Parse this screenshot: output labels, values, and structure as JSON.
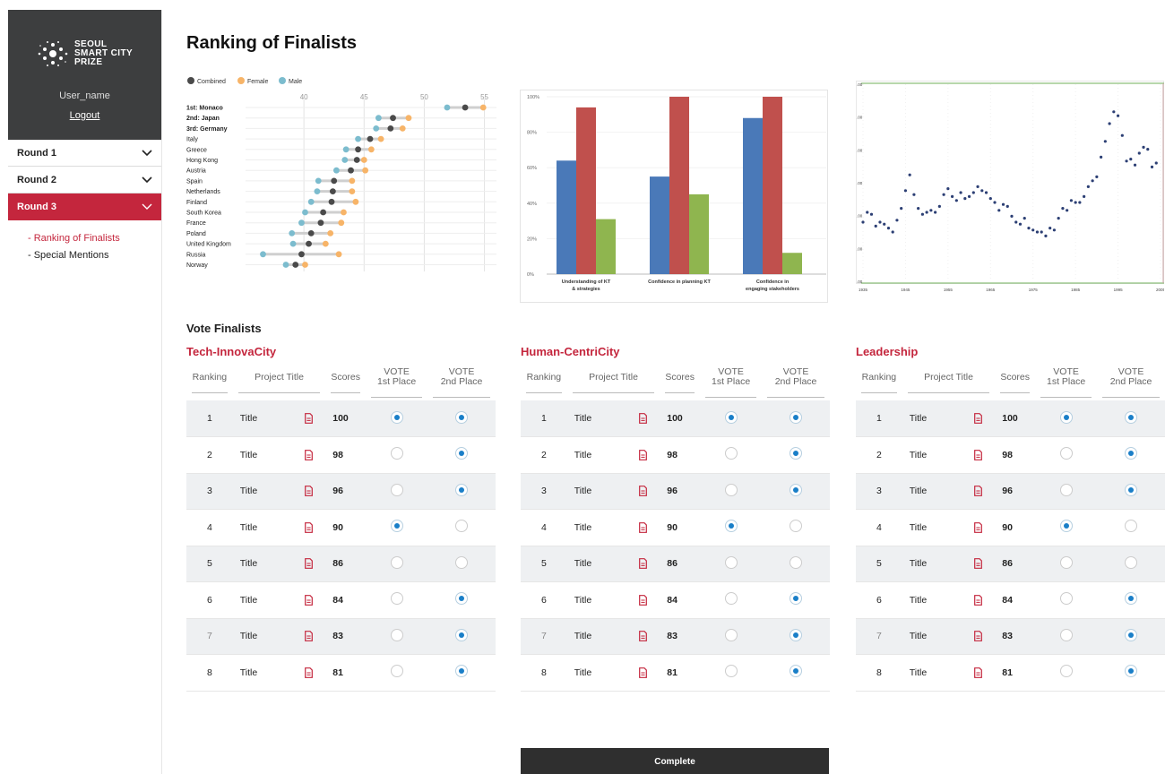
{
  "brand": {
    "logo_lines": [
      "SEOUL",
      "SMART CITY",
      "PRIZE"
    ],
    "user_name": "User_name",
    "logout_label": "Logout"
  },
  "sidebar": {
    "rounds": [
      {
        "label": "Round 1",
        "active": false
      },
      {
        "label": "Round 2",
        "active": false
      },
      {
        "label": "Round 3",
        "active": true
      }
    ],
    "subnav": [
      {
        "label": "- Ranking of Finalists",
        "selected": true
      },
      {
        "label": "- Special Mentions",
        "selected": false
      }
    ]
  },
  "main": {
    "title": "Ranking of Finalists",
    "vote_title": "Vote Finalists",
    "complete_label": "Complete"
  },
  "colors": {
    "accent": "#c4263d",
    "combined": "#4a4a4a",
    "female": "#f7b468",
    "male": "#7cbcce",
    "blue": "#4a79b8",
    "red": "#c0504d",
    "green": "#8fb54f",
    "radio": "#1a7fc8"
  },
  "chart_data": [
    {
      "type": "dot-plot",
      "legend": [
        "Combined",
        "Female",
        "Male"
      ],
      "xlim": [
        35,
        56
      ],
      "x_ticks": [
        40,
        45,
        50,
        55
      ],
      "countries": [
        "1st: Monaco",
        "2nd: Japan",
        "3rd: Germany",
        "Italy",
        "Greece",
        "Hong Kong",
        "Austria",
        "Spain",
        "Netherlands",
        "Finland",
        "South Korea",
        "France",
        "Poland",
        "United Kingdom",
        "Russia",
        "Norway"
      ],
      "bold_count": 3,
      "series": [
        {
          "name": "Combined",
          "values": [
            53.4,
            47.4,
            47.2,
            45.5,
            44.5,
            44.4,
            43.9,
            42.5,
            42.4,
            42.3,
            41.6,
            41.4,
            40.6,
            40.4,
            39.8,
            39.3
          ]
        },
        {
          "name": "Female",
          "values": [
            54.9,
            48.7,
            48.2,
            46.4,
            45.6,
            45.0,
            45.1,
            44.0,
            44.0,
            44.3,
            43.3,
            43.1,
            42.2,
            41.8,
            42.9,
            40.1
          ]
        },
        {
          "name": "Male",
          "values": [
            51.9,
            46.2,
            46.0,
            44.5,
            43.5,
            43.4,
            42.7,
            41.2,
            41.1,
            40.6,
            40.1,
            39.8,
            39.0,
            39.1,
            36.6,
            38.5
          ]
        }
      ]
    },
    {
      "type": "bar",
      "categories": [
        "Understanding of KT & strategies",
        "Confidence in planning KT",
        "Confidence in engaging stakeholders"
      ],
      "ylim": [
        0,
        100
      ],
      "y_ticks": [
        "0%",
        "20%",
        "40%",
        "60%",
        "80%",
        "100%"
      ],
      "series": [
        {
          "values": [
            64,
            55,
            88
          ]
        },
        {
          "values": [
            94,
            100,
            100
          ]
        },
        {
          "values": [
            31,
            45,
            12
          ]
        }
      ]
    },
    {
      "type": "scatter",
      "xlim": [
        1935,
        2005
      ],
      "x_ticks": [
        1935,
        1945,
        1955,
        1965,
        1975,
        1985,
        1995,
        2005
      ],
      "ylim": [
        0,
        100
      ],
      "y_tick_labels": [
        ".00",
        ".00",
        ".00",
        ".00",
        ".00",
        ".00",
        ".00"
      ],
      "points": [
        [
          1935,
          30
        ],
        [
          1936,
          35
        ],
        [
          1937,
          34
        ],
        [
          1938,
          28
        ],
        [
          1939,
          30
        ],
        [
          1940,
          29
        ],
        [
          1941,
          27
        ],
        [
          1942,
          25
        ],
        [
          1943,
          31
        ],
        [
          1944,
          37
        ],
        [
          1945,
          46
        ],
        [
          1946,
          54
        ],
        [
          1947,
          44
        ],
        [
          1948,
          37
        ],
        [
          1949,
          34
        ],
        [
          1950,
          35
        ],
        [
          1951,
          36
        ],
        [
          1952,
          35
        ],
        [
          1953,
          38
        ],
        [
          1954,
          44
        ],
        [
          1955,
          47
        ],
        [
          1956,
          43
        ],
        [
          1957,
          41
        ],
        [
          1958,
          45
        ],
        [
          1959,
          42
        ],
        [
          1960,
          43
        ],
        [
          1961,
          45
        ],
        [
          1962,
          48
        ],
        [
          1963,
          46
        ],
        [
          1964,
          45
        ],
        [
          1965,
          42
        ],
        [
          1966,
          40
        ],
        [
          1967,
          36
        ],
        [
          1968,
          39
        ],
        [
          1969,
          38
        ],
        [
          1970,
          33
        ],
        [
          1971,
          30
        ],
        [
          1972,
          29
        ],
        [
          1973,
          32
        ],
        [
          1974,
          27
        ],
        [
          1975,
          26
        ],
        [
          1976,
          25
        ],
        [
          1977,
          25
        ],
        [
          1978,
          23
        ],
        [
          1979,
          27
        ],
        [
          1980,
          26
        ],
        [
          1981,
          32
        ],
        [
          1982,
          37
        ],
        [
          1983,
          36
        ],
        [
          1984,
          41
        ],
        [
          1985,
          40
        ],
        [
          1986,
          40
        ],
        [
          1987,
          43
        ],
        [
          1988,
          48
        ],
        [
          1989,
          51
        ],
        [
          1990,
          53
        ],
        [
          1991,
          63
        ],
        [
          1992,
          71
        ],
        [
          1993,
          80
        ],
        [
          1994,
          86
        ],
        [
          1995,
          84
        ],
        [
          1996,
          74
        ],
        [
          1997,
          61
        ],
        [
          1998,
          62
        ],
        [
          1999,
          59
        ],
        [
          2000,
          65
        ],
        [
          2001,
          68
        ],
        [
          2002,
          67
        ],
        [
          2003,
          58
        ],
        [
          2004,
          60
        ]
      ]
    }
  ],
  "vote": {
    "headers": [
      "Ranking",
      "Project Title",
      "Scores",
      "VOTE 1st Place",
      "VOTE 2nd Place"
    ],
    "categories": [
      {
        "title": "Tech-InnovaCity",
        "rows": [
          {
            "rank": "1",
            "title": "Title",
            "score": "100",
            "first": true,
            "second": true
          },
          {
            "rank": "2",
            "title": "Title",
            "score": "98",
            "first": false,
            "second": true
          },
          {
            "rank": "3",
            "title": "Title",
            "score": "96",
            "first": false,
            "second": true
          },
          {
            "rank": "4",
            "title": "Title",
            "score": "90",
            "first": true,
            "second": false
          },
          {
            "rank": "5",
            "title": "Title",
            "score": "86",
            "first": false,
            "second": false
          },
          {
            "rank": "6",
            "title": "Title",
            "score": "84",
            "first": false,
            "second": true
          },
          {
            "rank": "7",
            "title": "Title",
            "score": "83",
            "first": false,
            "second": true
          },
          {
            "rank": "8",
            "title": "Title",
            "score": "81",
            "first": false,
            "second": true
          }
        ]
      },
      {
        "title": "Human-CentriCity",
        "rows": [
          {
            "rank": "1",
            "title": "Title",
            "score": "100",
            "first": true,
            "second": true
          },
          {
            "rank": "2",
            "title": "Title",
            "score": "98",
            "first": false,
            "second": true
          },
          {
            "rank": "3",
            "title": "Title",
            "score": "96",
            "first": false,
            "second": true
          },
          {
            "rank": "4",
            "title": "Title",
            "score": "90",
            "first": true,
            "second": false
          },
          {
            "rank": "5",
            "title": "Title",
            "score": "86",
            "first": false,
            "second": false
          },
          {
            "rank": "6",
            "title": "Title",
            "score": "84",
            "first": false,
            "second": true
          },
          {
            "rank": "7",
            "title": "Title",
            "score": "83",
            "first": false,
            "second": true
          },
          {
            "rank": "8",
            "title": "Title",
            "score": "81",
            "first": false,
            "second": true
          }
        ]
      },
      {
        "title": "Leadership",
        "rows": [
          {
            "rank": "1",
            "title": "Title",
            "score": "100",
            "first": true,
            "second": true
          },
          {
            "rank": "2",
            "title": "Title",
            "score": "98",
            "first": false,
            "second": true
          },
          {
            "rank": "3",
            "title": "Title",
            "score": "96",
            "first": false,
            "second": true
          },
          {
            "rank": "4",
            "title": "Title",
            "score": "90",
            "first": true,
            "second": false
          },
          {
            "rank": "5",
            "title": "Title",
            "score": "86",
            "first": false,
            "second": false
          },
          {
            "rank": "6",
            "title": "Title",
            "score": "84",
            "first": false,
            "second": true
          },
          {
            "rank": "7",
            "title": "Title",
            "score": "83",
            "first": false,
            "second": true
          },
          {
            "rank": "8",
            "title": "Title",
            "score": "81",
            "first": false,
            "second": true
          }
        ]
      }
    ]
  }
}
